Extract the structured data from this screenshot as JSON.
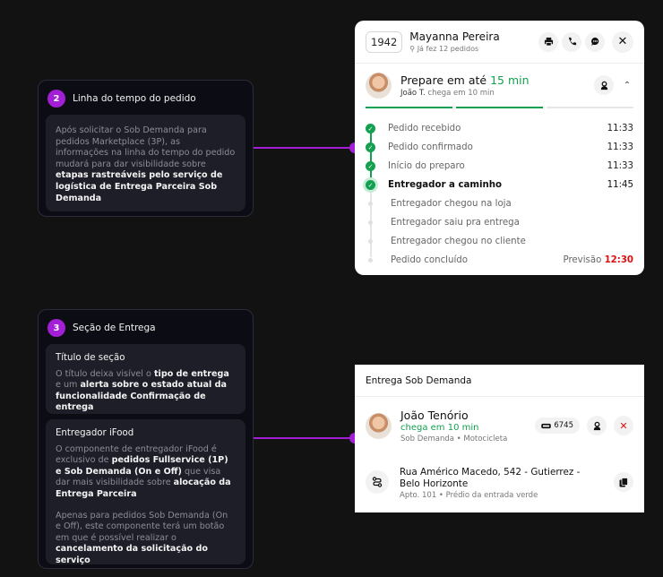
{
  "annotations": {
    "timeline": {
      "number": "2",
      "title": "Linha do tempo do pedido",
      "t1": "Após solicitar o Sob Demanda para pedidos Marketplace (3P), as informações na linha do tempo do pedido mudará para dar visibilidade sobre ",
      "t1_bold": "etapas rastreáveis pelo serviço de logística de Entrega Parceira Sob Demanda"
    },
    "delivery": {
      "number": "3",
      "title": "Seção de Entrega",
      "section_title": {
        "heading": "Título de seção",
        "t1": "O título deixa visível o ",
        "b1": "tipo de entrega",
        "t2": " e um ",
        "b2": "alerta sobre o estado atual da funcionalidade Confirmação de entrega"
      },
      "courier": {
        "heading": "Entregador iFood",
        "t1": "O componente de entregador iFood é exclusivo de ",
        "b1": "pedidos Fullservice (1P) e Sob Demanda (On e Off)",
        "t2": " que visa dar mais visibilidade sobre ",
        "b2": "alocação da Entrega Parceira",
        "t3": "Apenas para pedidos Sob Demanda (On e Off), este componente terá um botão em que é possível realizar o ",
        "b3": "cancelamento da solicitação do serviço"
      }
    }
  },
  "order": {
    "number": "1942",
    "customer_name": "Mayanna Pereira",
    "customer_sub": "Já fez 12 pedidos",
    "icons": [
      "printer-icon",
      "phone-icon",
      "chat-icon",
      "close-icon"
    ],
    "prep_prefix": "Prepare em até ",
    "prep_time": "15 min",
    "courier_name": "João T.",
    "courier_eta": " chega em 10 min",
    "progress": [
      1,
      1,
      0
    ],
    "timeline": [
      {
        "label": "Pedido recebido",
        "time": "11:33",
        "state": "done"
      },
      {
        "label": "Pedido confirmado",
        "time": "11:33",
        "state": "done"
      },
      {
        "label": "Início do preparo",
        "time": "11:33",
        "state": "done"
      },
      {
        "label": "Entregador a caminho",
        "time": "11:45",
        "state": "current"
      },
      {
        "label": "Entregador chegou na loja",
        "time": "",
        "state": "pending"
      },
      {
        "label": "Entregador saiu pra entrega",
        "time": "",
        "state": "pending"
      },
      {
        "label": "Entregador chegou no cliente",
        "time": "",
        "state": "pending"
      },
      {
        "label": "Pedido concluído",
        "time": "",
        "state": "pending"
      }
    ],
    "forecast_label": "Previsão ",
    "forecast_time": "12:30",
    "colors": {
      "green": "#13a050",
      "red": "#d11111",
      "accent": "#a21fd6"
    }
  },
  "delivery": {
    "title": "Entrega Sob Demanda",
    "courier_name": "João Tenório",
    "courier_eta": "chega em 10 min",
    "courier_sub": "Sob Demanda • Motocicleta",
    "plate": "6745",
    "address": "Rua Américo Macedo, 542 - Gutierrez - Belo Horizonte",
    "address_sub": "Apto. 101 • Prédio da entrada verde"
  }
}
